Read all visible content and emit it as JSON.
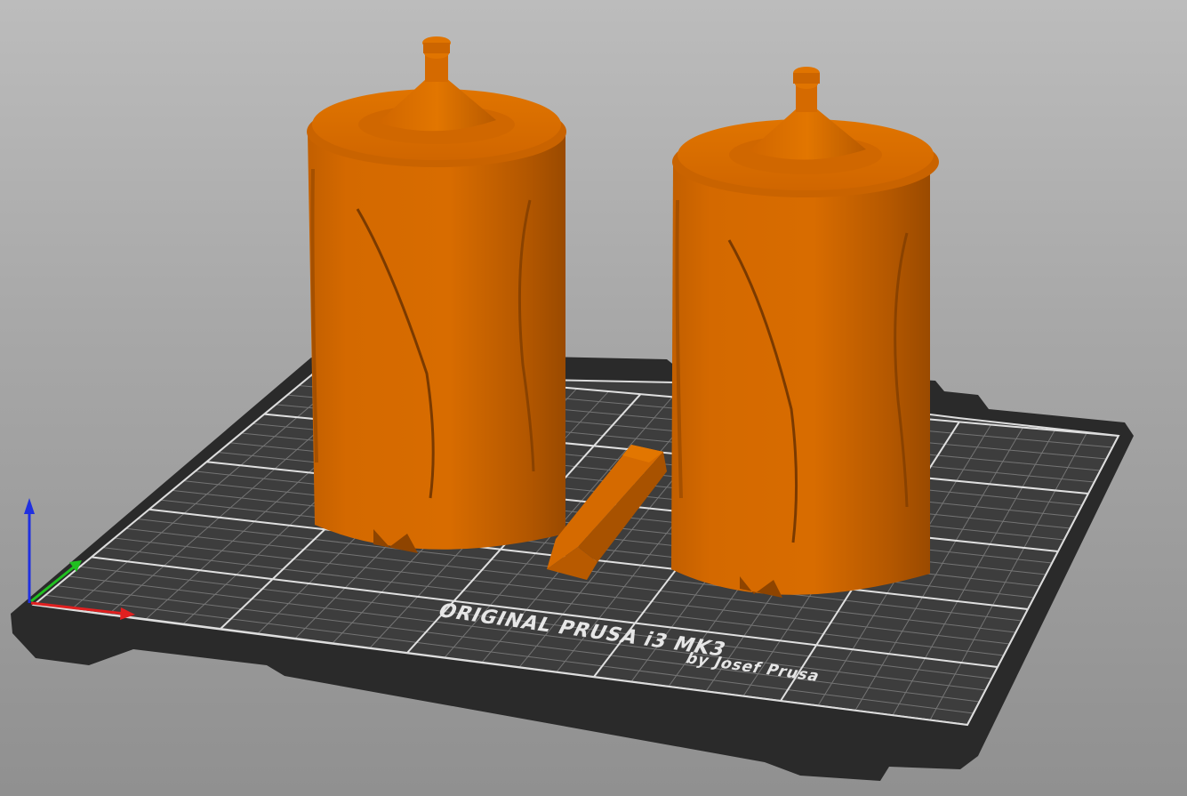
{
  "viewport": {
    "background": "#a8a8a8"
  },
  "bed": {
    "model_label": "ORIGINAL PRUSA i3 MK3",
    "brand_label": "by Josef Prusa",
    "sheet_color": "#3a3a3a",
    "frame_color": "#222222",
    "grid_color": "#d8d8d8"
  },
  "objects": [
    {
      "name": "cylinder-left",
      "color": "#d66b00"
    },
    {
      "name": "wedge-center",
      "color": "#d66b00"
    },
    {
      "name": "cylinder-right",
      "color": "#d66b00"
    }
  ],
  "axes": {
    "x_color": "#e02020",
    "y_color": "#20c020",
    "z_color": "#2030e0"
  }
}
